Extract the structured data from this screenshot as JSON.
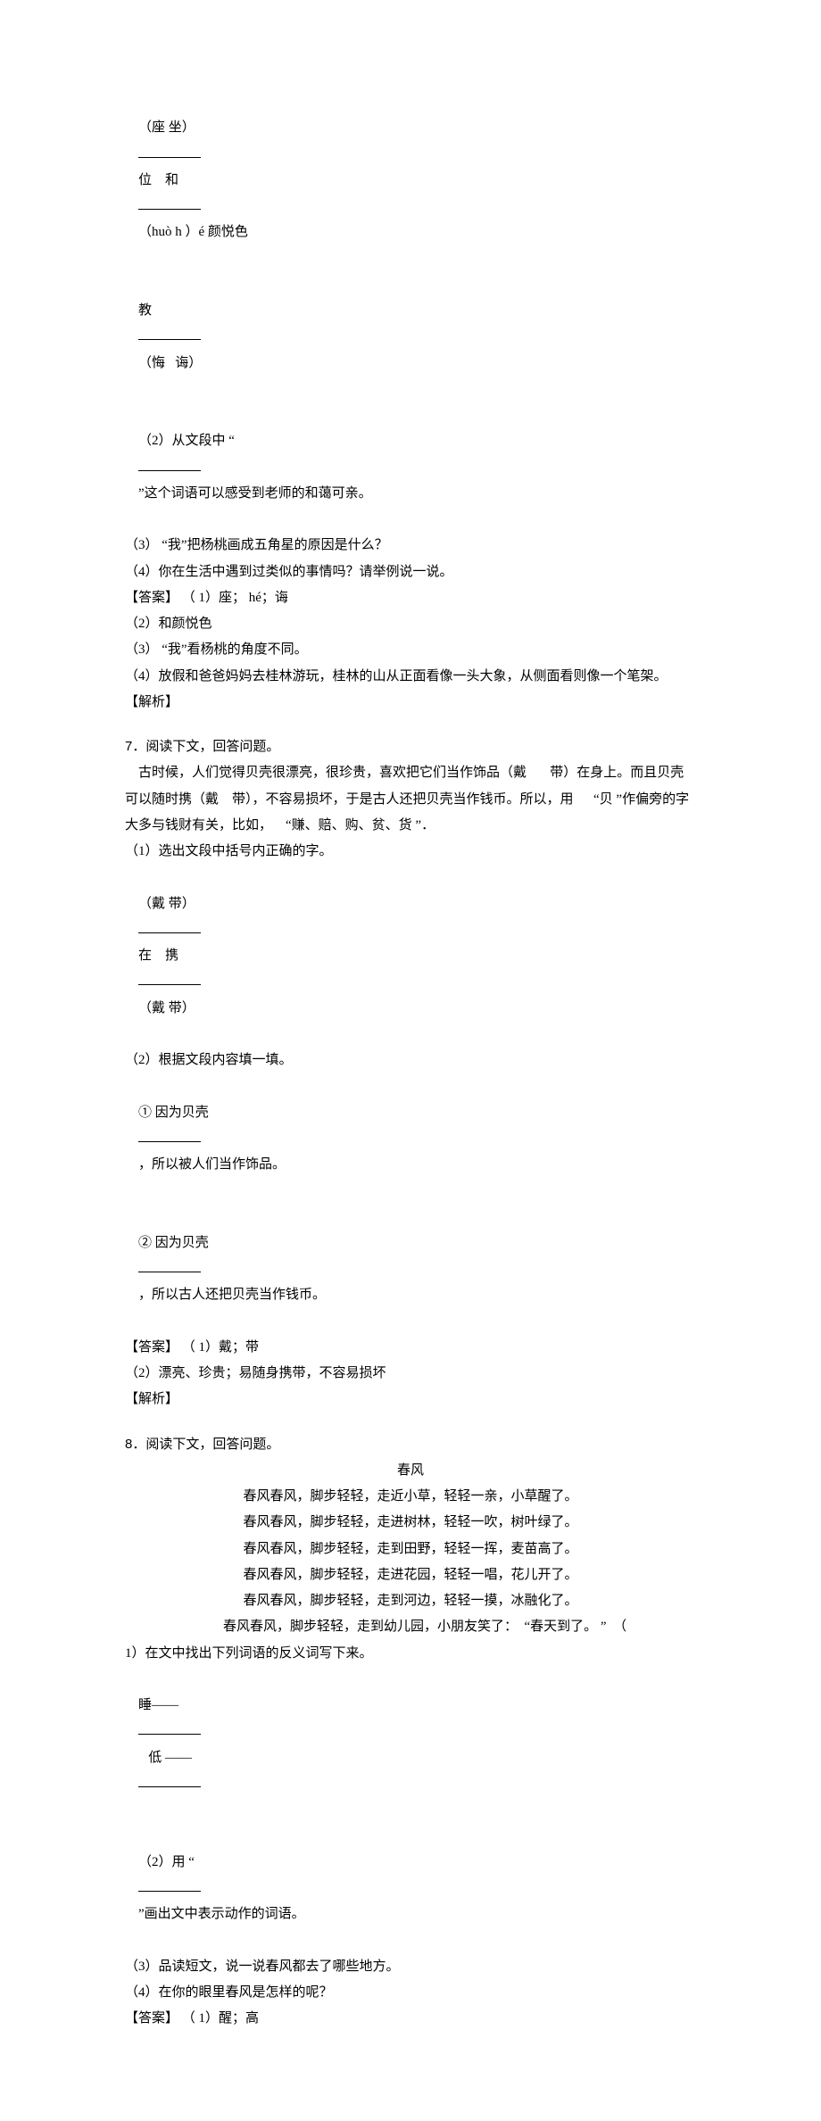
{
  "l1a": "（座 坐）",
  "l1b": "位    和 ",
  "l1c": "（huò h ）é 颜悦色",
  "l2a": "教",
  "l2b": "（悔   诲）",
  "l3a": "（2）从文段中 “",
  "l3b": "”这个词语可以感受到老师的和蔼可亲。",
  "l4": "（3） “我”把杨桃画成五角星的原因是什么？",
  "l5": "（4）你在生活中遇到过类似的事情吗？请举例说一说。",
  "l6": "【答案】 （ 1）座； hé；诲",
  "l7": "（2）和颜悦色",
  "l8": "（3） “我”看杨桃的角度不同。",
  "l9": "（4）放假和爸爸妈妈去桂林游玩，桂林的山从正面看像一头大象，从侧面看则像一个笔架。",
  "l10": "【解析】",
  "q7_title": "7．阅读下文，回答问题。",
  "q7_para": "    古时候，人们觉得贝壳很漂亮，很珍贵，喜欢把它们当作饰品（戴       带）在身上。而且贝壳可以随时携（戴    带），不容易损坏，于是古人还把贝壳当作钱币。所以，用      “贝 ”作偏旁的字大多与钱财有关，比如，    “赚、赔、购、贫、货 ”．",
  "q7_1": "（1）选出文段中括号内正确的字。",
  "q7_1a": "（戴 带） ",
  "q7_1b": "在    携 ",
  "q7_1c": "（戴 带）",
  "q7_2": "（2）根据文段内容填一填。",
  "q7_2_1a": "① 因为贝壳 ",
  "q7_2_1b": "，所以被人们当作饰品。",
  "q7_2_2a": "② 因为贝壳 ",
  "q7_2_2b": "，所以古人还把贝壳当作钱币。",
  "q7_ans1": "【答案】 （ 1）戴；带",
  "q7_ans2": "（2）漂亮、珍贵；易随身携带，不容易损坏",
  "q7_exp": "【解析】",
  "q8_title": "8．阅读下文，回答问题。",
  "q8_poem_title": "春风",
  "q8_p1": "春风春风，脚步轻轻，走近小草，轻轻一亲，小草醒了。",
  "q8_p2": "春风春风，脚步轻轻，走进树林，轻轻一吹，树叶绿了。",
  "q8_p3": "春风春风，脚步轻轻，走到田野，轻轻一挥，麦苗高了。",
  "q8_p4": "春风春风，脚步轻轻，走进花园，轻轻一唱，花儿开了。",
  "q8_p5": "春风春风，脚步轻轻，走到河边，轻轻一摸，冰融化了。",
  "q8_p6a": "春风春风，脚步轻轻，走到幼儿园，小朋友笑了：  “春天到了。 ”  （",
  "q8_p6b": "1）在文中找出下列词语的反义词写下来。",
  "q8_1a": "睡——  ",
  "q8_1b": "   低 ——",
  "q8_2a": "（2）用 “",
  "q8_2b": "”画出文中表示动作的词语。",
  "q8_3": "（3）品读短文，说一说春风都去了哪些地方。",
  "q8_4": "（4）在你的眼里春风是怎样的呢？",
  "q8_ans": "【答案】 （ 1）醒；高"
}
